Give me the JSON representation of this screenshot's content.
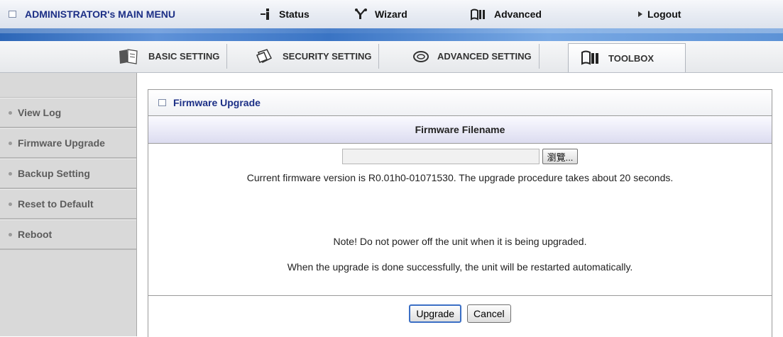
{
  "top_menu": {
    "admin_title": "ADMINISTRATOR's MAIN MENU",
    "items": [
      {
        "label": "Status",
        "icon": "status-icon"
      },
      {
        "label": "Wizard",
        "icon": "wizard-icon"
      },
      {
        "label": "Advanced",
        "icon": "advanced-icon"
      },
      {
        "label": "Logout",
        "icon": "triangle-right-icon"
      }
    ]
  },
  "tabs": [
    {
      "label": "BASIC SETTING",
      "icon": "book-icon"
    },
    {
      "label": "SECURITY SETTING",
      "icon": "security-icon"
    },
    {
      "label": "ADVANCED SETTING",
      "icon": "advanced-setting-icon"
    },
    {
      "label": "TOOLBOX",
      "icon": "toolbox-icon",
      "active": true
    }
  ],
  "sidebar": {
    "items": [
      {
        "label": "View Log"
      },
      {
        "label": "Firmware Upgrade",
        "active": true
      },
      {
        "label": "Backup Setting"
      },
      {
        "label": "Reset to Default"
      },
      {
        "label": "Reboot"
      }
    ]
  },
  "panel": {
    "title": "Firmware Upgrade",
    "column_header": "Firmware Filename",
    "file_input_value": "",
    "browse_label": "瀏覽...",
    "version_text": "Current firmware version is R0.01h0-01071530. The upgrade procedure takes about 20 seconds.",
    "note1": "Note! Do not power off the unit when it is being upgraded.",
    "note2": "When the upgrade is done successfully, the unit will be restarted automatically.",
    "upgrade_label": "Upgrade",
    "cancel_label": "Cancel"
  },
  "colors": {
    "title_blue": "#1c2f86",
    "stripe_blue": "#3a74c4",
    "sidebar_bg": "#d9d9d9"
  }
}
